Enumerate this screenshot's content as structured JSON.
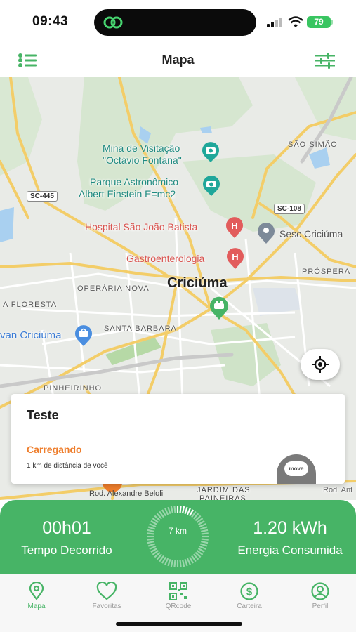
{
  "status_bar": {
    "time": "09:43",
    "battery": "79"
  },
  "header": {
    "title": "Mapa",
    "left_icon": "list-icon",
    "right_icon": "sliders-icon"
  },
  "map": {
    "labels": {
      "mina": "Mina de Visitação",
      "mina2": "\"Octávio Fontana\"",
      "parque": "Parque Astronômico",
      "parque2": "Albert Einstein E=mc2",
      "hospital": "Hospital São João Batista",
      "gastro": "Gastroenterologia",
      "sesc": "Sesc Criciúma",
      "city": "Criciúma",
      "operaria": "OPERÁRIA NOVA",
      "floresta": "A FLORESTA",
      "santa_barbara": "SANTA BARBARA",
      "havan": "van Criciúma",
      "pinheirinho": "PINHEIRINHO",
      "sao_simao": "SÃO SIMÃO",
      "prospera": "PRÓSPERA",
      "sc445": "SC-445",
      "sc108": "SC-108",
      "jardim": "JARDIM DAS",
      "paineiras": "PAINEIRAS",
      "rod_alexandre": "Rod. Alexandre Beloli",
      "rod_ant": "Rod. Ant"
    }
  },
  "station_card": {
    "name": "Teste",
    "status": "Carregando",
    "distance": "1 km de distância de você",
    "badge": "move"
  },
  "charging": {
    "elapsed_value": "00h01",
    "elapsed_label": "Tempo Decorrido",
    "distance": "7 km",
    "energy_value": "1.20 kWh",
    "energy_label": "Energia Consumida"
  },
  "nav": {
    "items": [
      {
        "label": "Mapa",
        "icon": "map-pin-icon"
      },
      {
        "label": "Favoritas",
        "icon": "heart-icon"
      },
      {
        "label": "QRcode",
        "icon": "qrcode-icon"
      },
      {
        "label": "Carteira",
        "icon": "dollar-icon"
      },
      {
        "label": "Perfil",
        "icon": "user-icon"
      }
    ]
  },
  "colors": {
    "primary_green": "#47b466",
    "status_orange": "#ee7d2b",
    "hospital_red": "#e25c5c",
    "poi_teal": "#1fa79a"
  }
}
